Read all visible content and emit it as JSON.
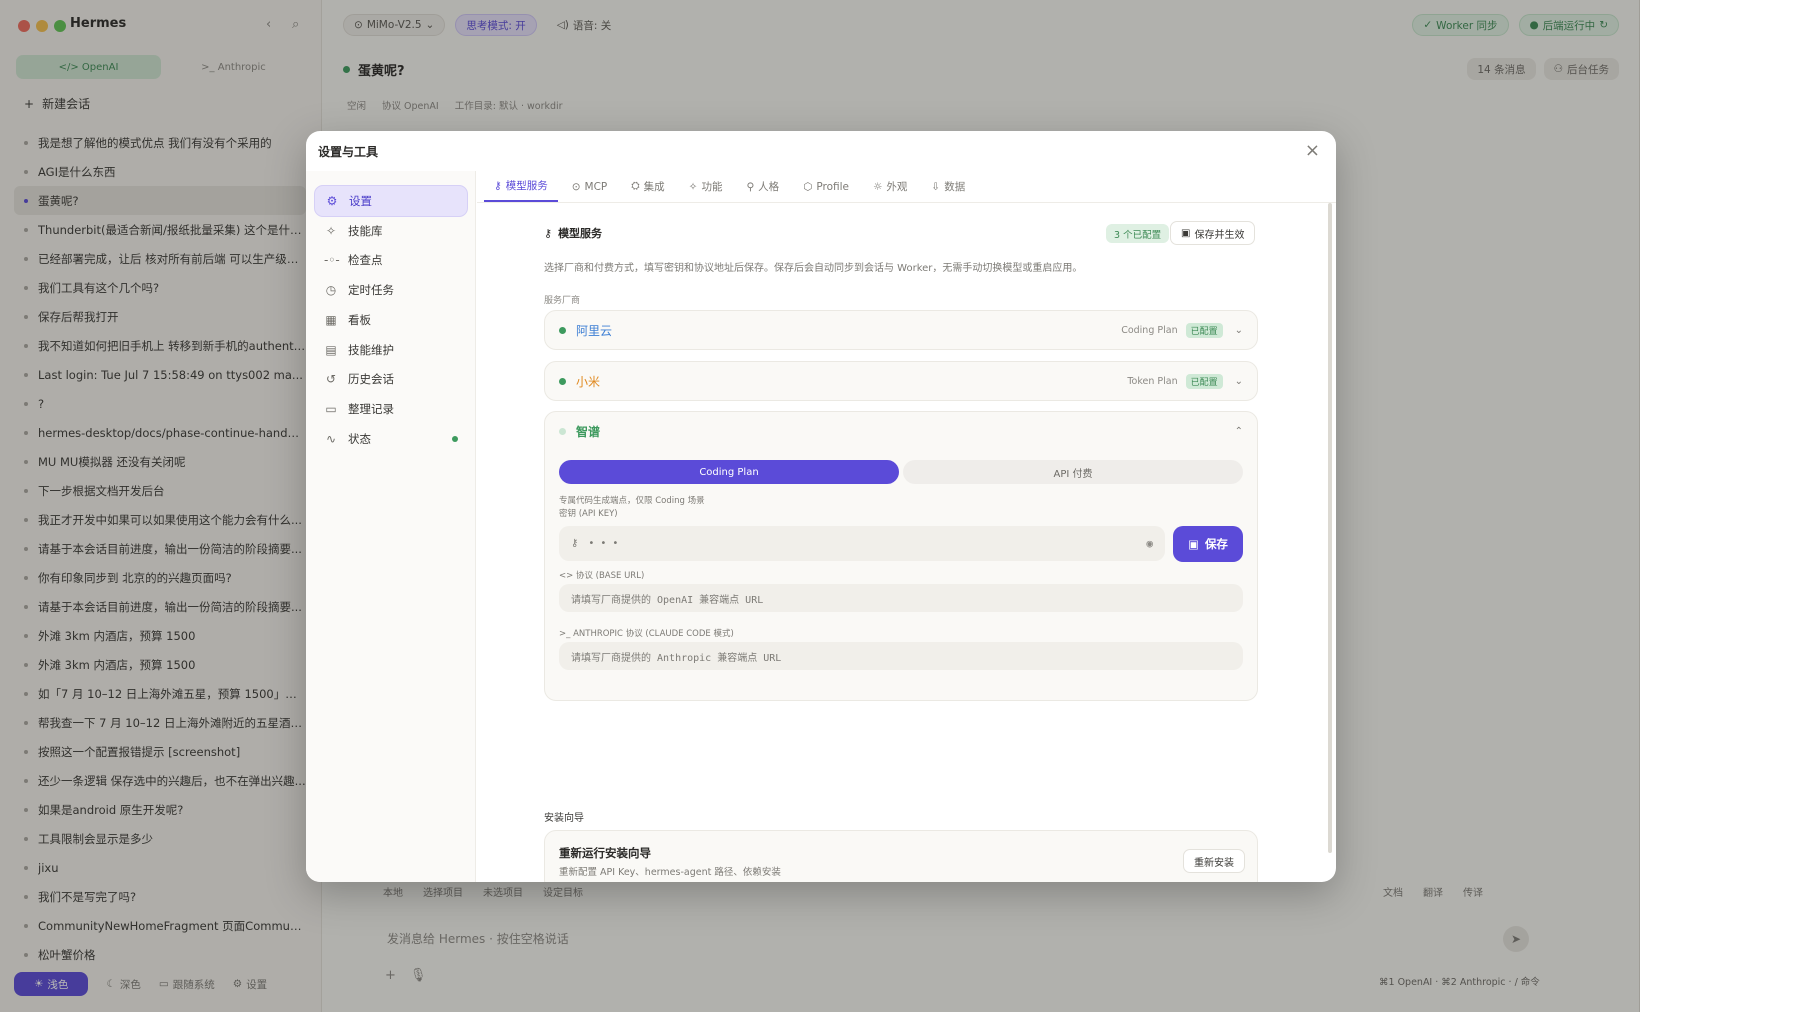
{
  "colors": {
    "accent": "#5b4bd8",
    "success": "#3d9a5e"
  },
  "sidebar": {
    "app_title": "Hermes",
    "protocol_tabs": [
      {
        "label": "</> OpenAI"
      },
      {
        "label": ">_ Anthropic"
      }
    ],
    "new_chat": "新建会话",
    "chats": [
      "我是想了解他的模式优点 我们有没有个采用的",
      "AGI是什么东西",
      "蛋黄呢?",
      "Thunderbit(最适合新闻/报纸批量采集) 这个是什么...",
      "已经部署完成，让后 核对所有前后端 可以生产级交...",
      "我们工具有这个几个吗?",
      "保存后帮我打开",
      "我不知道如何把旧手机上 转移到新手机的authenti...",
      "Last login: Tue Jul 7 15:58:49 on ttys002 ma...",
      "?",
      "hermes-desktop/docs/phase-continue-handoff...",
      "MU MU模拟器 还没有关闭呢",
      "下一步根据文档开发后台",
      "我正才开发中如果可以如果使用这个能力会有什么...",
      "请基于本会话目前进度，输出一份简洁的阶段摘要...",
      "你有印象同步到 北京的的兴趣页面吗?",
      "请基于本会话目前进度，输出一份简洁的阶段摘要...",
      "外滩 3km 内酒店，预算 1500",
      "外滩 3km 内酒店，预算 1500",
      "如「7 月 10–12 日上海外滩五星，预算 1500」在...",
      "帮我查一下 7 月 10–12 日上海外滩附近的五星酒店...",
      "按照这一个配置报错提示 [screenshot]",
      "还少一条逻辑 保存选中的兴趣后，也不在弹出兴趣...",
      "如果是android 原生开发呢?",
      "工具限制会显示是多少",
      "jixu",
      "我们不是写完了吗?",
      "CommunityNewHomeFragment 页面Communit...",
      "松叶蟹价格"
    ],
    "themes": [
      {
        "label": "浅色"
      },
      {
        "label": "深色"
      },
      {
        "label": "跟随系统"
      },
      {
        "label": "设置"
      }
    ]
  },
  "main": {
    "model": "MiMo-V2.5",
    "think_mode": "思考模式: 开",
    "voice": "语音: 关",
    "worker_sync": "Worker 同步",
    "backend_running": "后端运行中",
    "chat_title": "蛋黄呢?",
    "msg_count": "14 条消息",
    "bg_tasks": "后台任务",
    "meta": [
      "空闲",
      "协议 OpenAI",
      "工作目录: 默认 · workdir"
    ],
    "bottom_tools": [
      "本地",
      "选择项目",
      "未选项目",
      "设定目标"
    ],
    "bottom_tools_right": [
      "文档",
      "翻译",
      "传译"
    ],
    "composer_placeholder": "发消息给 Hermes · 按住空格说话",
    "shortcuts": "⌘1 OpenAI · ⌘2 Anthropic · / 命令"
  },
  "modal": {
    "title": "设置与工具",
    "nav": [
      {
        "label": "设置",
        "icon": "gear-icon"
      },
      {
        "label": "技能库",
        "icon": "sparkle-icon"
      },
      {
        "label": "检查点",
        "icon": "checkpoint-icon"
      },
      {
        "label": "定时任务",
        "icon": "clock-icon"
      },
      {
        "label": "看板",
        "icon": "grid-icon"
      },
      {
        "label": "技能维护",
        "icon": "clipboard-icon"
      },
      {
        "label": "历史会话",
        "icon": "history-icon"
      },
      {
        "label": "整理记录",
        "icon": "archive-icon"
      },
      {
        "label": "状态",
        "icon": "pulse-icon"
      }
    ],
    "tabs": [
      {
        "label": "模型服务"
      },
      {
        "label": "MCP"
      },
      {
        "label": "集成"
      },
      {
        "label": "功能"
      },
      {
        "label": "人格"
      },
      {
        "label": "Profile"
      },
      {
        "label": "外观"
      },
      {
        "label": "数据"
      }
    ],
    "section_title": "模型服务",
    "configured_badge": "3 个已配置",
    "save_apply": "保存并生效",
    "description": "选择厂商和付费方式，填写密钥和协议地址后保存。保存后会自动同步到会话与 Worker，无需手动切换模型或重启应用。",
    "vendor_label": "服务厂商",
    "vendors": [
      {
        "name": "阿里云",
        "plan": "Coding Plan",
        "status": "已配置",
        "color": "#3d7fd4"
      },
      {
        "name": "小米",
        "plan": "Token Plan",
        "status": "已配置",
        "color": "#e0891f"
      },
      {
        "name": "智谱",
        "color": "#3d9a5e"
      }
    ],
    "zhipu": {
      "plan_options": [
        "Coding Plan",
        "API 付费"
      ],
      "plan_hint": "专属代码生成端点，仅限 Coding 场景",
      "api_key_label": "密钥 (API KEY)",
      "api_key_value": "• • •",
      "save": "保存",
      "base_url_label": "<> 协议 (BASE URL)",
      "base_url_placeholder": "请填写厂商提供的 OpenAI 兼容端点 URL",
      "anthropic_label": ">_ ANTHROPIC 协议 (CLAUDE CODE 模式)",
      "anthropic_placeholder": "请填写厂商提供的 Anthropic 兼容端点 URL"
    },
    "install_label": "安装向导",
    "install_title": "重新运行安装向导",
    "install_sub": "重新配置 API Key、hermes-agent 路径、依赖安装",
    "reinstall": "重新安装"
  }
}
